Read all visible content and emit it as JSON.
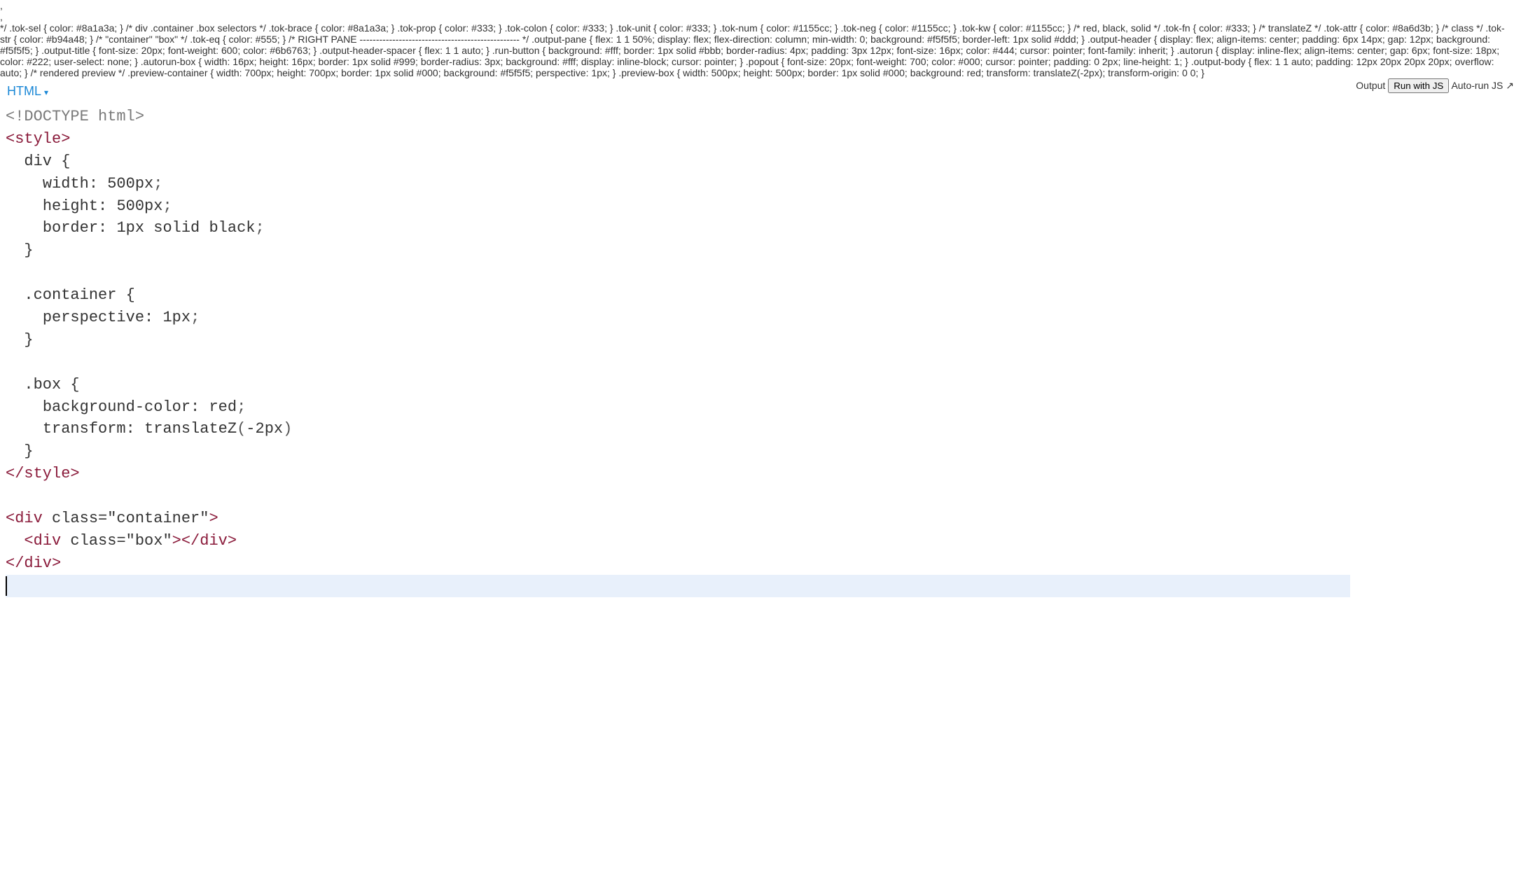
{
  "editor": {
    "language_label": "HTML",
    "code_lines": [
      [
        {
          "t": "<!",
          "c": "tok-doctype"
        },
        {
          "t": "DOCTYPE html",
          "c": "tok-doctype"
        },
        {
          "t": ">",
          "c": "tok-doctype"
        }
      ],
      [
        {
          "t": "<style>",
          "c": "tok-tag"
        }
      ],
      [
        {
          "t": "  ",
          "c": "tok-text"
        },
        {
          "t": "div",
          "c": "tok-sel"
        },
        {
          "t": " ",
          "c": "tok-text"
        },
        {
          "t": "{",
          "c": "tok-brace"
        }
      ],
      [
        {
          "t": "    ",
          "c": "tok-text"
        },
        {
          "t": "width",
          "c": "tok-prop"
        },
        {
          "t": ":",
          "c": "tok-colon"
        },
        {
          "t": " ",
          "c": "tok-text"
        },
        {
          "t": "500",
          "c": "tok-num"
        },
        {
          "t": "px",
          "c": "tok-unit"
        },
        {
          "t": ";",
          "c": "tok-punct"
        }
      ],
      [
        {
          "t": "    ",
          "c": "tok-text"
        },
        {
          "t": "height",
          "c": "tok-prop"
        },
        {
          "t": ":",
          "c": "tok-colon"
        },
        {
          "t": " ",
          "c": "tok-text"
        },
        {
          "t": "500",
          "c": "tok-num"
        },
        {
          "t": "px",
          "c": "tok-unit"
        },
        {
          "t": ";",
          "c": "tok-punct"
        }
      ],
      [
        {
          "t": "    ",
          "c": "tok-text"
        },
        {
          "t": "border",
          "c": "tok-prop"
        },
        {
          "t": ":",
          "c": "tok-colon"
        },
        {
          "t": " ",
          "c": "tok-text"
        },
        {
          "t": "1",
          "c": "tok-num"
        },
        {
          "t": "px",
          "c": "tok-unit"
        },
        {
          "t": " ",
          "c": "tok-text"
        },
        {
          "t": "solid",
          "c": "tok-kw"
        },
        {
          "t": " ",
          "c": "tok-text"
        },
        {
          "t": "black",
          "c": "tok-kw"
        },
        {
          "t": ";",
          "c": "tok-punct"
        }
      ],
      [
        {
          "t": "  ",
          "c": "tok-text"
        },
        {
          "t": "}",
          "c": "tok-brace"
        }
      ],
      [],
      [
        {
          "t": "  ",
          "c": "tok-text"
        },
        {
          "t": ".container",
          "c": "tok-sel"
        },
        {
          "t": " ",
          "c": "tok-text"
        },
        {
          "t": "{",
          "c": "tok-brace"
        }
      ],
      [
        {
          "t": "    ",
          "c": "tok-text"
        },
        {
          "t": "perspective",
          "c": "tok-prop"
        },
        {
          "t": ":",
          "c": "tok-colon"
        },
        {
          "t": " ",
          "c": "tok-text"
        },
        {
          "t": "1",
          "c": "tok-num"
        },
        {
          "t": "px",
          "c": "tok-unit"
        },
        {
          "t": ";",
          "c": "tok-punct"
        }
      ],
      [
        {
          "t": "  ",
          "c": "tok-text"
        },
        {
          "t": "}",
          "c": "tok-brace"
        }
      ],
      [],
      [
        {
          "t": "  ",
          "c": "tok-text"
        },
        {
          "t": ".box",
          "c": "tok-sel"
        },
        {
          "t": " ",
          "c": "tok-text"
        },
        {
          "t": "{",
          "c": "tok-brace"
        }
      ],
      [
        {
          "t": "    ",
          "c": "tok-text"
        },
        {
          "t": "background-color",
          "c": "tok-prop"
        },
        {
          "t": ":",
          "c": "tok-colon"
        },
        {
          "t": " ",
          "c": "tok-text"
        },
        {
          "t": "red",
          "c": "tok-kw"
        },
        {
          "t": ";",
          "c": "tok-punct"
        }
      ],
      [
        {
          "t": "    ",
          "c": "tok-text"
        },
        {
          "t": "transform",
          "c": "tok-prop"
        },
        {
          "t": ":",
          "c": "tok-colon"
        },
        {
          "t": " ",
          "c": "tok-text"
        },
        {
          "t": "translateZ",
          "c": "tok-fn"
        },
        {
          "t": "(",
          "c": "tok-punct"
        },
        {
          "t": "-2",
          "c": "tok-neg"
        },
        {
          "t": "px",
          "c": "tok-unit"
        },
        {
          "t": ")",
          "c": "tok-punct"
        }
      ],
      [
        {
          "t": "  ",
          "c": "tok-text"
        },
        {
          "t": "}",
          "c": "tok-brace"
        }
      ],
      [
        {
          "t": "</style>",
          "c": "tok-tag"
        }
      ],
      [],
      [
        {
          "t": "<div ",
          "c": "tok-tag"
        },
        {
          "t": "class",
          "c": "tok-attr"
        },
        {
          "t": "=",
          "c": "tok-eq"
        },
        {
          "t": "\"container\"",
          "c": "tok-str"
        },
        {
          "t": ">",
          "c": "tok-tag"
        }
      ],
      [
        {
          "t": "  ",
          "c": "tok-text"
        },
        {
          "t": "<div ",
          "c": "tok-tag"
        },
        {
          "t": "class",
          "c": "tok-attr"
        },
        {
          "t": "=",
          "c": "tok-eq"
        },
        {
          "t": "\"box\"",
          "c": "tok-str"
        },
        {
          "t": ">",
          "c": "tok-tag"
        },
        {
          "t": "</div>",
          "c": "tok-tag"
        }
      ],
      [
        {
          "t": "</div>",
          "c": "tok-tag"
        }
      ],
      []
    ],
    "cursor_line_index": 21
  },
  "output": {
    "title": "Output",
    "run_button_label": "Run with JS",
    "autorun_label": "Auto-run JS",
    "autorun_checked": false,
    "popout_glyph": "↗",
    "preview": {
      "container_size_px": 700,
      "box_color": "red",
      "box_border": "1px solid black"
    }
  }
}
